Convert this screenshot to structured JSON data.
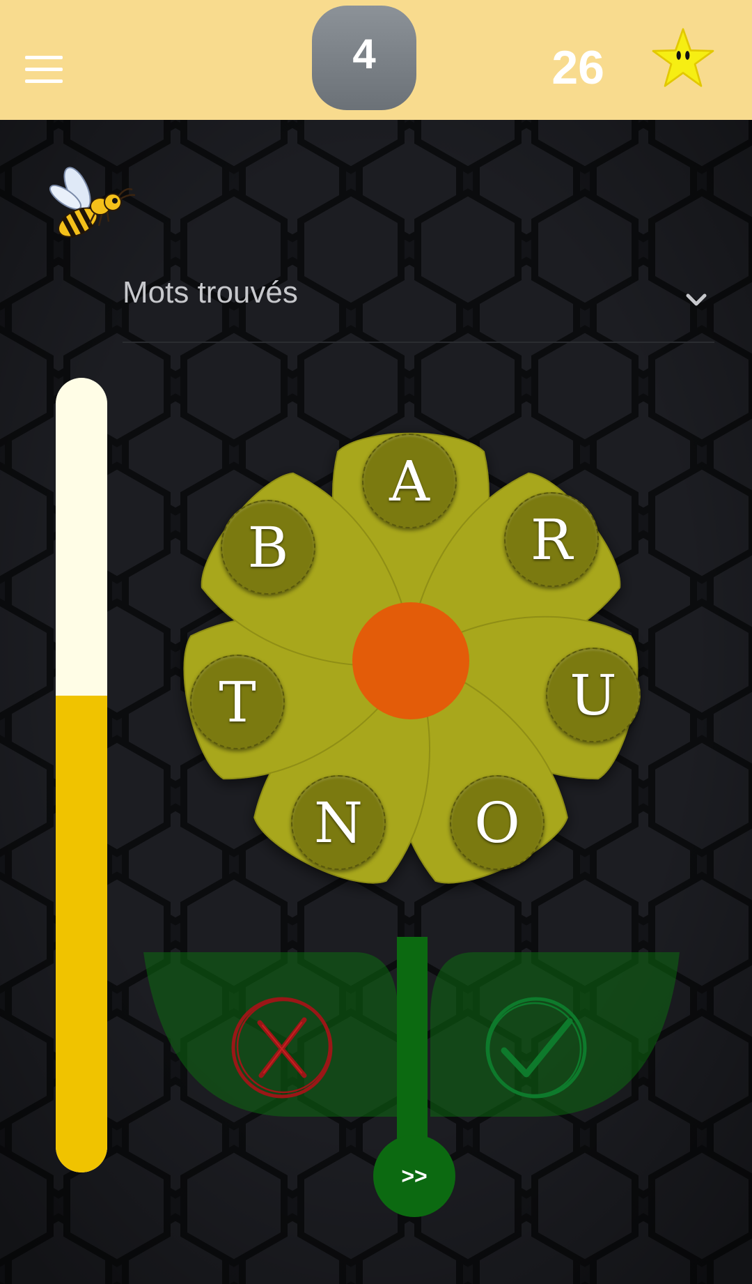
{
  "header": {
    "level": "4",
    "score": "26",
    "menu_icon": "hamburger-menu-icon",
    "star_icon": "star-icon"
  },
  "found_words": {
    "label": "Mots trouvés",
    "icon": "chevron-down-icon"
  },
  "progress": {
    "fraction": 0.6
  },
  "flower": {
    "letters": [
      "A",
      "R",
      "U",
      "O",
      "N",
      "T",
      "B"
    ],
    "colors": {
      "petal": "#a8a71a",
      "letter_disc": "#7b7a10",
      "center": "#e35c09"
    }
  },
  "controls": {
    "reject_icon": "x-circle-icon",
    "accept_icon": "check-circle-icon",
    "next_label": ">>"
  },
  "colors": {
    "header_bg": "#f8db8e",
    "progress_fill": "#f0c300",
    "progress_empty": "#fffde6",
    "leaf": "#0c6a11"
  }
}
